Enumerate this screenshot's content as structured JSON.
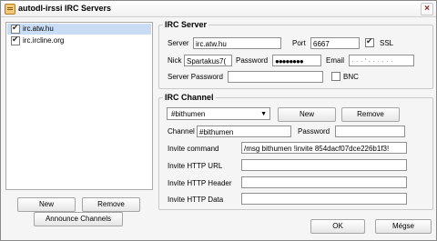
{
  "window": {
    "title": "autodl-irssi IRC Servers",
    "close_glyph": "×"
  },
  "servers": [
    {
      "name": "irc.atw.hu",
      "checked": true,
      "selected": true
    },
    {
      "name": "irc.ircline.org",
      "checked": true,
      "selected": false
    }
  ],
  "buttons": {
    "new": "New",
    "remove": "Remove",
    "announce": "Announce Channels",
    "ok": "OK",
    "cancel": "Mégse"
  },
  "irc_server": {
    "legend": "IRC Server",
    "server_label": "Server",
    "server_value": "irc.atw.hu",
    "port_label": "Port",
    "port_value": "6667",
    "ssl_label": "SSL",
    "ssl_checked": true,
    "nick_label": "Nick",
    "nick_value": "Spartakus7(",
    "password_label": "Password",
    "password_value": "●●●●●●●●",
    "email_label": "Email",
    "email_value": "·  ·  ·  ' ·  ·  ·  ·  ·  ·",
    "server_password_label": "Server Password",
    "server_password_value": "",
    "bnc_label": "BNC",
    "bnc_checked": false
  },
  "irc_channel": {
    "legend": "IRC Channel",
    "channel_select": "#bithumen",
    "new": "New",
    "remove": "Remove",
    "channel_label": "Channel",
    "channel_value": "#bithumen",
    "password_label": "Password",
    "password_value": "",
    "invite_command_label": "Invite command",
    "invite_command_value": "/msg bithumen !invite 854dacf07dce226b1f3!",
    "invite_url_label": "Invite HTTP URL",
    "invite_url_value": "",
    "invite_header_label": "Invite HTTP Header",
    "invite_header_value": "",
    "invite_data_label": "Invite HTTP Data",
    "invite_data_value": ""
  },
  "icons": {
    "app": "irc-servers-icon",
    "close": "close-icon",
    "check": "checkmark-icon",
    "dropdown": "chevron-down-icon"
  }
}
